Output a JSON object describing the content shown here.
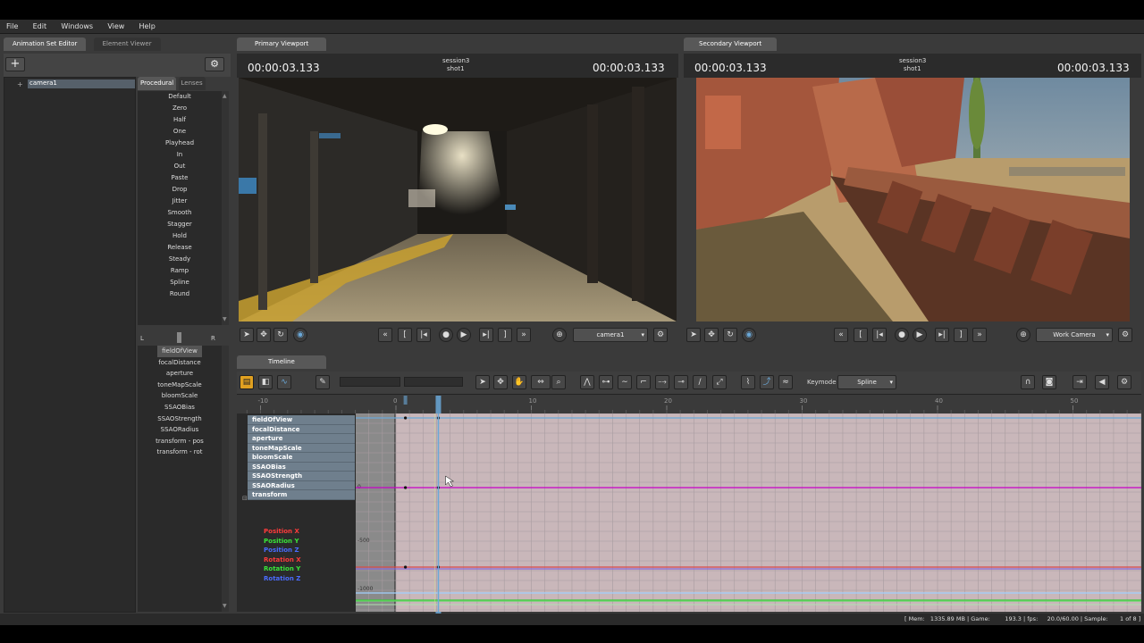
{
  "menu": [
    "File",
    "Edit",
    "Windows",
    "View",
    "Help"
  ],
  "left_panel": {
    "tabs": [
      "Animation Set Editor",
      "Element Viewer"
    ],
    "tree_item": "camera1",
    "preset_tabs": [
      "Procedural",
      "Lenses"
    ],
    "presets": [
      "Default",
      "Zero",
      "Half",
      "One",
      "Playhead",
      "In",
      "Out",
      "Paste",
      "Drop",
      "Jitter",
      "Smooth",
      "Stagger",
      "Hold",
      "Release",
      "Steady",
      "Ramp",
      "Spline",
      "Round"
    ],
    "slider_left": "L",
    "slider_right": "R",
    "attributes": [
      "fieldOfView",
      "focalDistance",
      "aperture",
      "toneMapScale",
      "bloomScale",
      "SSAOBias",
      "SSAOStrength",
      "SSAORadius",
      "transform - pos",
      "transform - rot"
    ]
  },
  "primary_viewport": {
    "tab": "Primary Viewport",
    "time_left": "00:00:03.133",
    "time_right": "00:00:03.133",
    "session": "session3",
    "shot": "shot1",
    "camera": "camera1"
  },
  "secondary_viewport": {
    "tab": "Secondary Viewport",
    "time_left": "00:00:03.133",
    "time_right": "00:00:03.133",
    "session": "session3",
    "shot": "shot1",
    "camera": "Work Camera"
  },
  "timeline": {
    "tab": "Timeline",
    "keymode_label": "Keymode",
    "keymode_value": "Spline",
    "ruler_ticks": [
      "-10",
      "0",
      "10",
      "20",
      "30",
      "40",
      "50"
    ],
    "value_labels": [
      "0",
      "-500",
      "-1000"
    ],
    "channels": [
      "fieldOfView",
      "focalDistance",
      "aperture",
      "toneMapScale",
      "bloomScale",
      "SSAOBias",
      "SSAOStrength",
      "SSAORadius",
      "transform"
    ],
    "transform_channels": [
      {
        "label": "Position X",
        "color": "#ff3b3b"
      },
      {
        "label": "Position Y",
        "color": "#39e639"
      },
      {
        "label": "Position Z",
        "color": "#4a6cff"
      },
      {
        "label": "Rotation X",
        "color": "#ff3b3b"
      },
      {
        "label": "Rotation Y",
        "color": "#39e639"
      },
      {
        "label": "Rotation Z",
        "color": "#4a6cff"
      }
    ],
    "playhead_frame": 3.133
  },
  "status_bar": {
    "text": "[ Mem:   1335.89 MB | Game:        193.3 | fps:     20.0/60.00 | Sample:",
    "page": "1 of 8 ]"
  },
  "colors": {
    "attr_highlight": "#6f7f8d",
    "curve_magenta": "#c800c8",
    "graph_bg": "#c9b7ba",
    "playhead": "#6aa8d8"
  }
}
